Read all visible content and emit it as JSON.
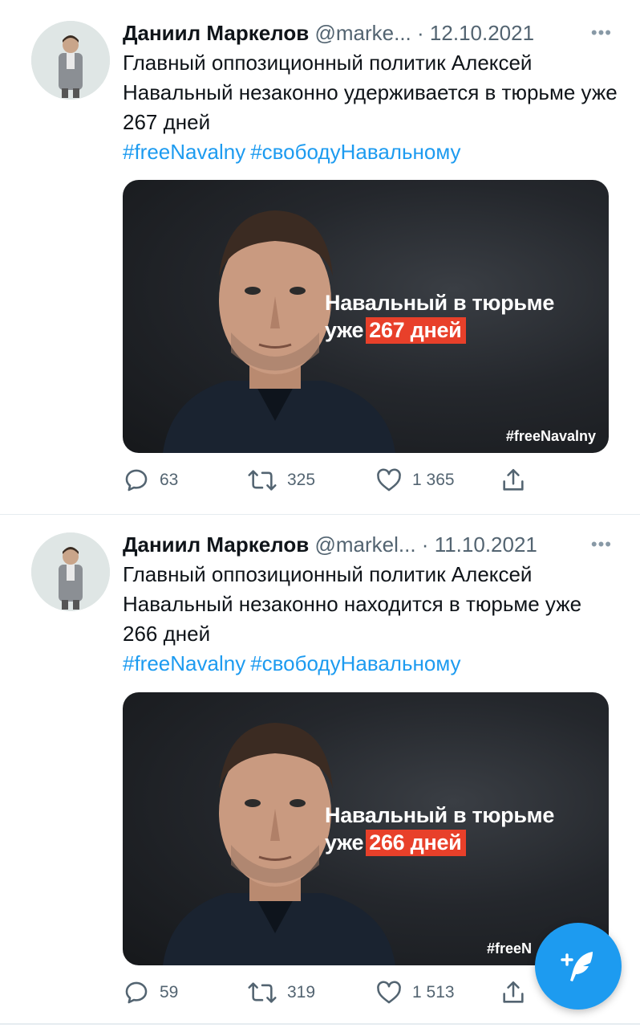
{
  "tweets": [
    {
      "author_name": "Даниил Маркелов",
      "handle": "@marke...",
      "separator": "·",
      "date": "12.10.2021",
      "more": "•••",
      "text": "Главный оппозиционный политик Алексей Навальный незаконно удерживается в тюрьме уже 267 дней",
      "hashtags": [
        "#freeNavalny",
        "#свободуНавальному"
      ],
      "media": {
        "headline_line1": "Навальный в тюрьме",
        "headline_prefix": "уже",
        "headline_highlight": "267 дней",
        "overlay_tag": "#freeNavalny"
      },
      "replies": "63",
      "retweets": "325",
      "likes": "1 365"
    },
    {
      "author_name": "Даниил Маркелов",
      "handle": "@markel...",
      "separator": "·",
      "date": "11.10.2021",
      "more": "•••",
      "text": "Главный оппозиционный политик Алексей Навальный незаконно находится в тюрьме уже 266 дней",
      "hashtags": [
        "#freeNavalny",
        "#свободуНавальному"
      ],
      "media": {
        "headline_line1": "Навальный в тюрьме",
        "headline_prefix": "уже",
        "headline_highlight": "266 дней",
        "overlay_tag": "#freeN"
      },
      "replies": "59",
      "retweets": "319",
      "likes": "1 513"
    }
  ],
  "colors": {
    "accent": "#1d9bf0",
    "highlight_red": "#e8402a",
    "muted_text": "#536471"
  },
  "icons": [
    "reply-icon",
    "retweet-icon",
    "like-icon",
    "share-icon",
    "compose-tweet-icon",
    "more-icon"
  ]
}
